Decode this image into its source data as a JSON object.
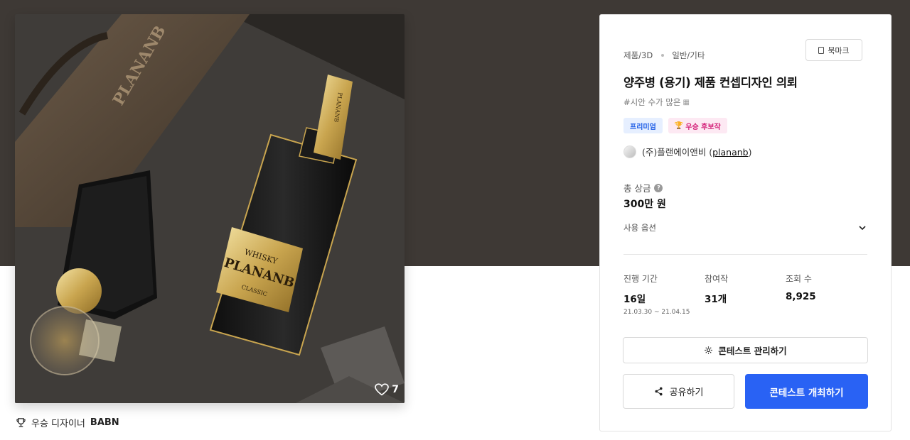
{
  "image": {
    "like_count": "7",
    "bottle_label": {
      "top": "WHISKY",
      "brand": "PLANANB",
      "bottom": "CLASSIC",
      "neck": "PLANANB",
      "box": "PLANANB"
    },
    "icons": {
      "like": "heart-icon"
    }
  },
  "winner": {
    "prefix": "우승 디자이너",
    "name": "BABN",
    "icon": "trophy-icon"
  },
  "panel": {
    "category": "제품/3D",
    "subcategory": "일반/기타",
    "bookmark_label": "북마크",
    "title": "양주병 (용기) 제품 컨셉디자인 의뢰",
    "hashtag": "#시안 수가 많은",
    "badges": {
      "premium": "프리미엄",
      "candidate": "우승 후보작"
    },
    "host": {
      "name": "(주)플랜에이앤비 (",
      "handle": "plananb",
      "suffix": ")"
    },
    "prize": {
      "label": "총 상금",
      "help": "?",
      "value": "300만 원"
    },
    "usage_options": "사용 옵션",
    "stats": {
      "period_label": "진행 기간",
      "period_value": "16일",
      "period_range": "21.03.30 ~ 21.04.15",
      "entries_label": "참여작",
      "entries_value": "31개",
      "views_label": "조회 수",
      "views_value": "8,925"
    },
    "manage_button": "콘테스트 관리하기",
    "share_button": "공유하기",
    "host_button": "콘테스트 개최하기"
  },
  "colors": {
    "hero_band": "#3e3935",
    "primary": "#2962f4",
    "premium_badge": "#1b5be6",
    "candidate_badge": "#d4227a"
  }
}
